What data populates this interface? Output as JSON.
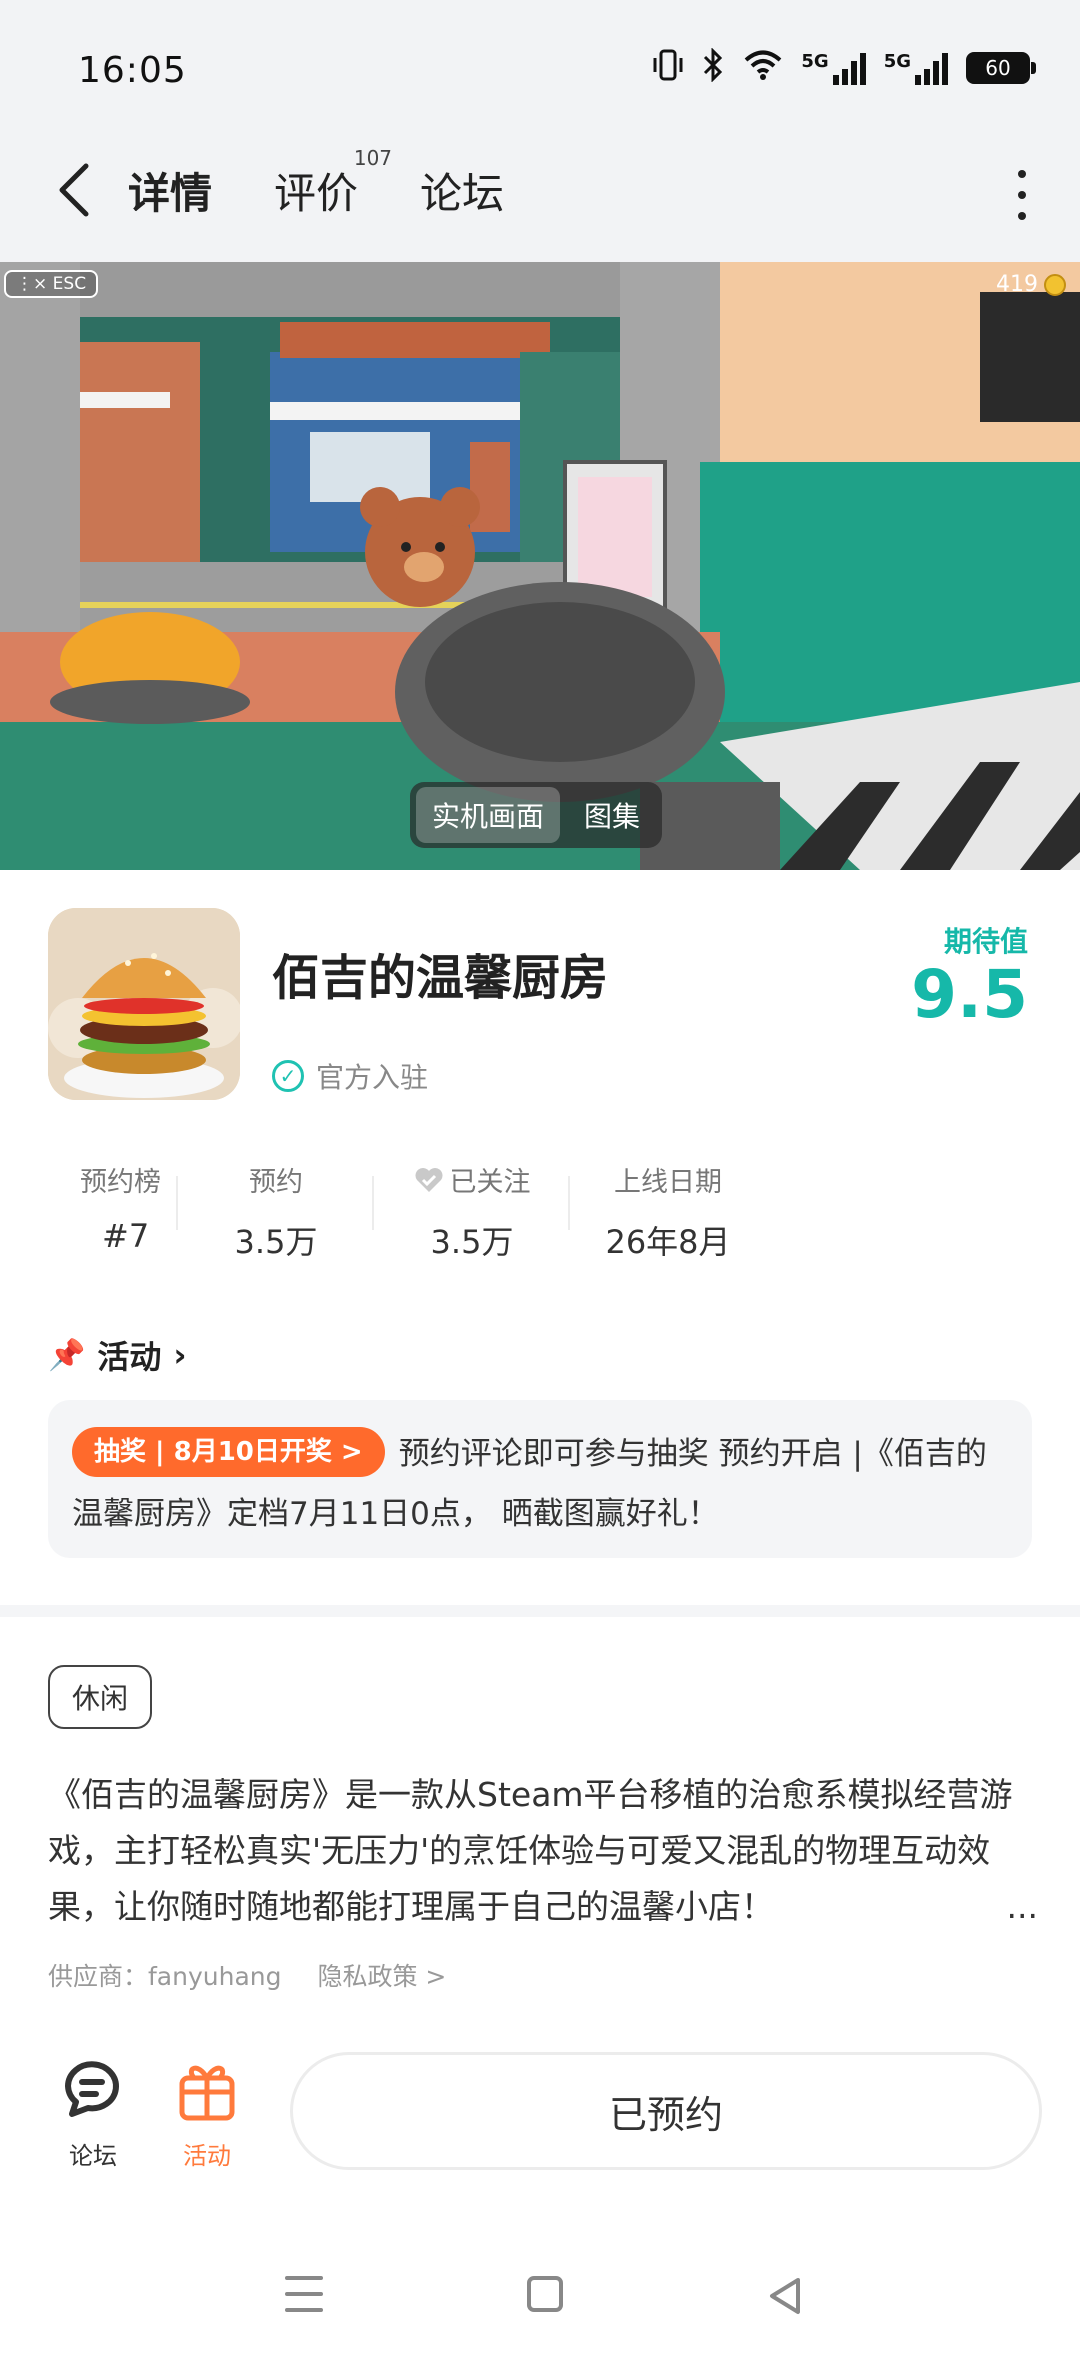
{
  "status_bar": {
    "time": "16:05",
    "network_1": "5G",
    "network_2": "5G",
    "battery": "60"
  },
  "nav": {
    "tabs": [
      {
        "label": "详情",
        "active": true
      },
      {
        "label": "评价",
        "badge": "107"
      },
      {
        "label": "论坛"
      }
    ]
  },
  "hero": {
    "esc_label": "ESC",
    "coins": "419",
    "toggle": [
      "实机画面",
      "图集"
    ]
  },
  "game": {
    "title": "佰吉的温馨厨房",
    "official_label": "官方入驻",
    "expect_label": "期待值",
    "expect_value": "9.5",
    "stats": [
      {
        "label": "预约榜",
        "value": "#7"
      },
      {
        "label": "预约",
        "value": "3.5万"
      },
      {
        "label": "已关注",
        "value": "3.5万"
      },
      {
        "label": "上线日期",
        "value": "26年8月"
      }
    ]
  },
  "activity": {
    "heading": "活动",
    "tag": "抽奖 | 8月10日开奖 >",
    "text": "预约评论即可参与抽奖 预约开启 |《佰吉的温馨厨房》定档7月11日0点， 晒截图赢好礼！"
  },
  "description": {
    "genre": "休闲",
    "text": "《佰吉的温馨厨房》是一款从Steam平台移植的治愈系模拟经营游戏，主打轻松真实'无压力'的烹饪体验与可爱又混乱的物理互动效果，让你随时随地都能打理属于自己的温馨小店！",
    "ellipsis": "...",
    "supplier": "供应商：fanyuhang",
    "privacy": "隐私政策 >"
  },
  "bottom_bar": {
    "forum_label": "论坛",
    "activity_label": "活动",
    "reserve_label": "已预约"
  },
  "colors": {
    "accent": "#1fd1c0",
    "expect": "#16b8a9",
    "activity_orange": "#ff6a2c"
  }
}
